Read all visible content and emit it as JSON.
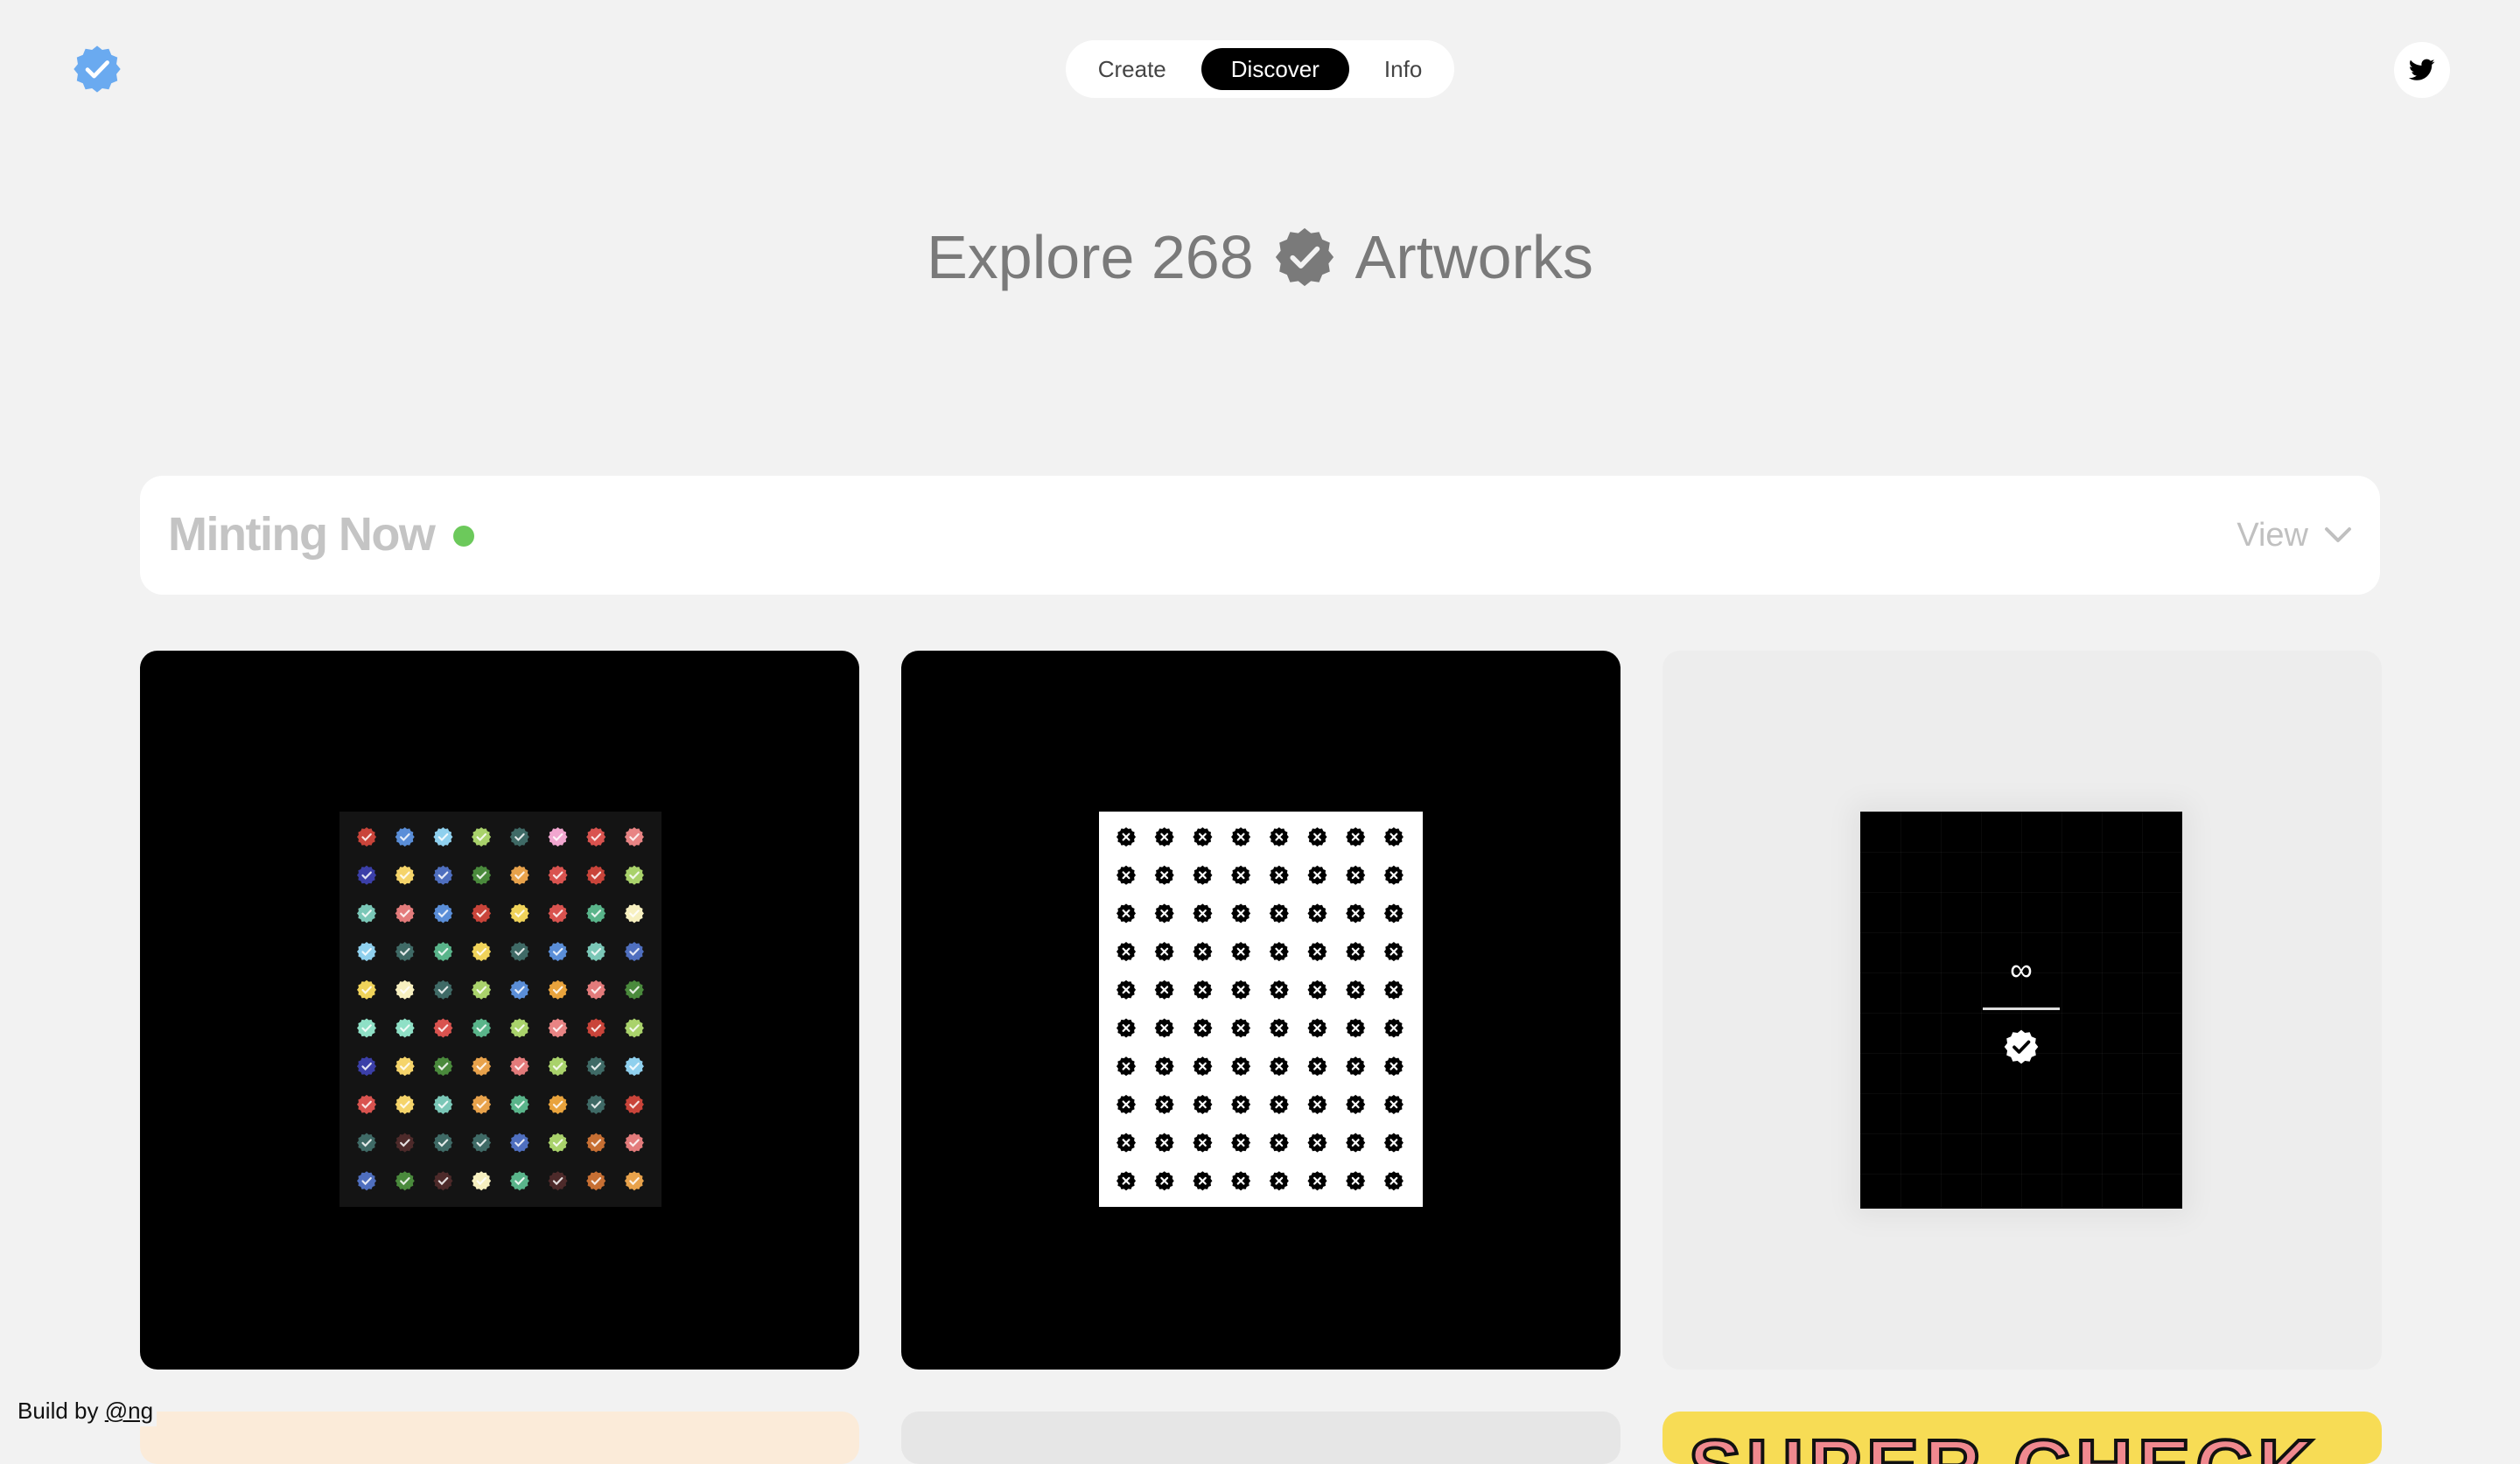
{
  "nav": {
    "items": [
      {
        "label": "Create",
        "active": false
      },
      {
        "label": "Discover",
        "active": true
      },
      {
        "label": "Info",
        "active": false
      }
    ]
  },
  "hero": {
    "prefix": "Explore 268",
    "suffix": "Artworks"
  },
  "minting": {
    "title": "Minting Now",
    "status_color": "#6cc95b",
    "view_label": "View"
  },
  "artworks": [
    {
      "name": "colorful-checks-grid"
    },
    {
      "name": "black-x-grid"
    },
    {
      "name": "infinity-check",
      "symbol": "∞"
    }
  ],
  "peek_cards": [
    {
      "name": "peek-card-1"
    },
    {
      "name": "peek-card-2"
    },
    {
      "name": "peek-card-3",
      "text": "SUPER CHECK"
    }
  ],
  "footer": {
    "prefix": "Build by ",
    "handle": "@ng"
  },
  "colors": {
    "background": "#f2f2f2",
    "accent": "#6aaaf0",
    "live": "#6cc95b"
  }
}
